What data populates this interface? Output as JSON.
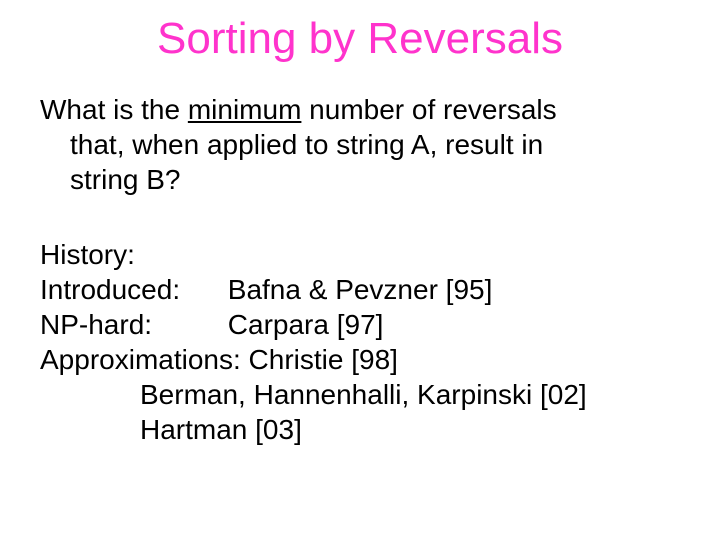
{
  "title": "Sorting by Reversals",
  "question": {
    "pre": "What is the ",
    "underlined": "minimum",
    "post1": " number of reversals",
    "line2": "that, when applied to string A, result in",
    "line3": "string B?"
  },
  "history": {
    "heading": "History:",
    "introduced_label": "Introduced:",
    "introduced_value": "Bafna & Pevzner [95]",
    "nphard_label": "NP-hard:",
    "nphard_value": "Carpara [97]",
    "approx_label": "Approximations:",
    "approx_value": "Christie [98]",
    "extra1": "Berman, Hannenhalli, Karpinski [02]",
    "extra2": "Hartman [03]"
  }
}
